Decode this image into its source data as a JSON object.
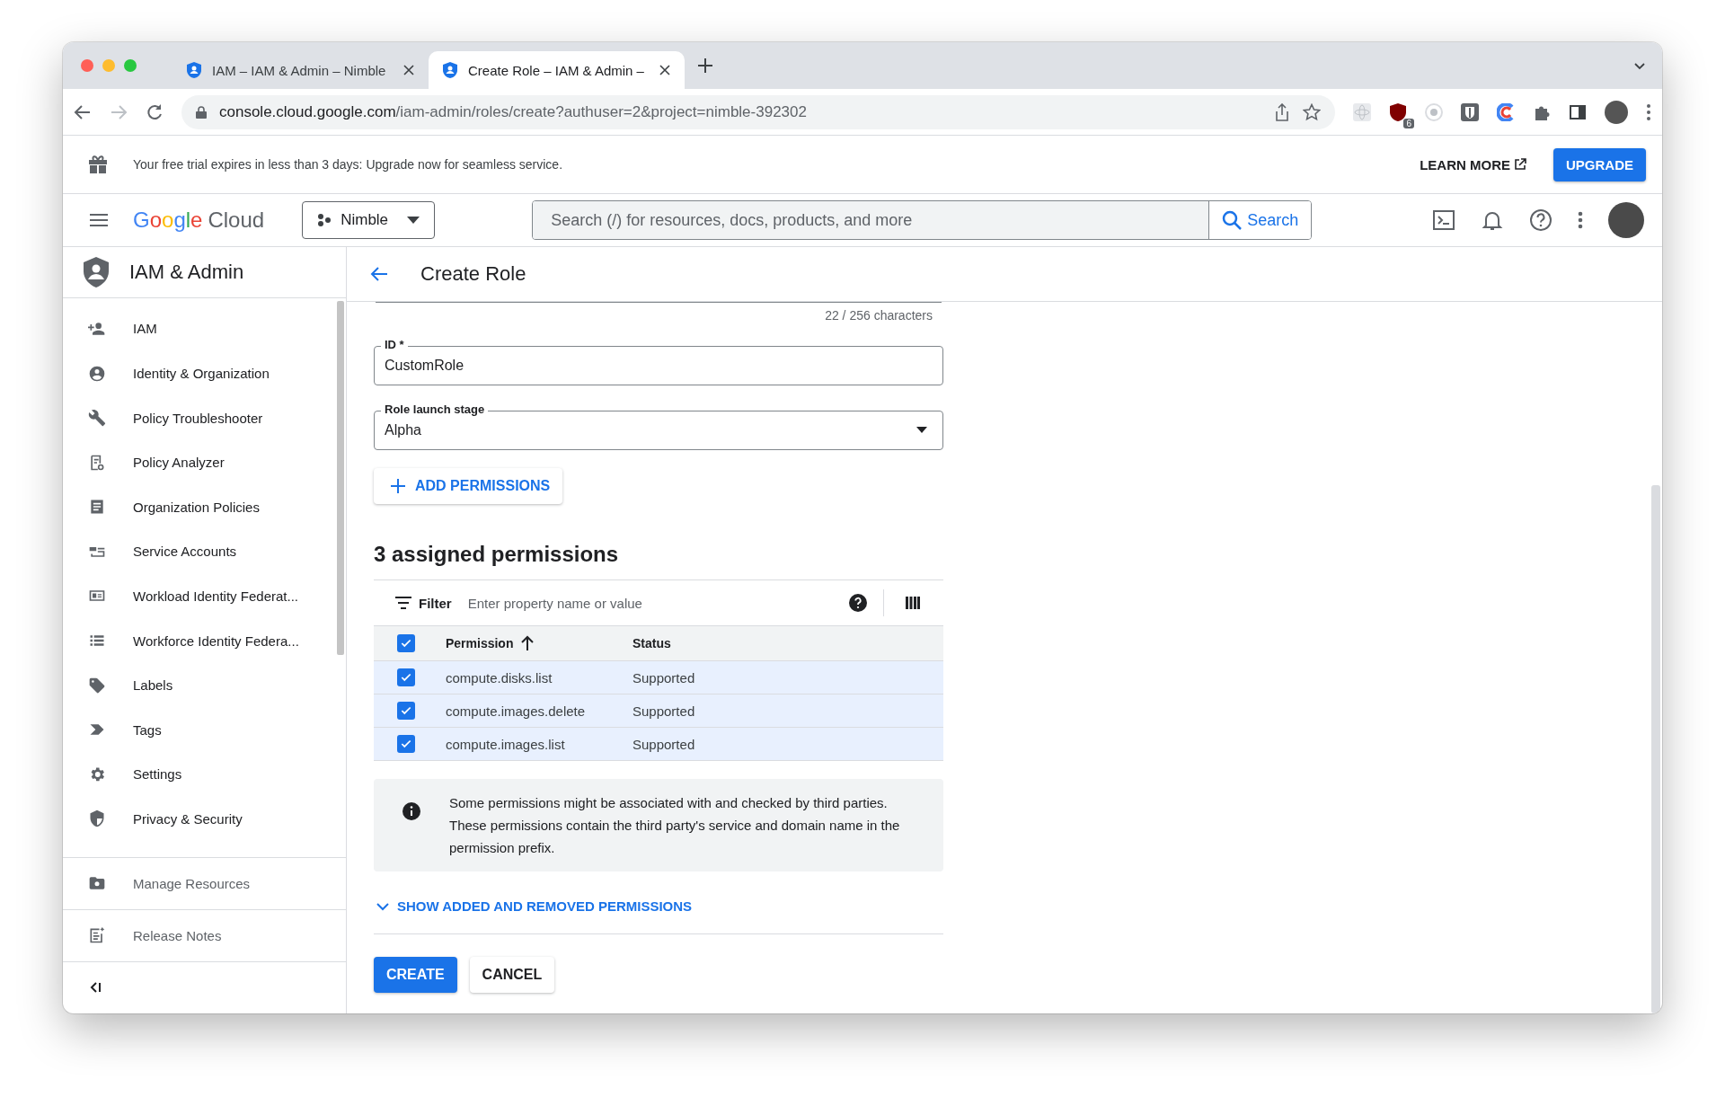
{
  "browser": {
    "tabs": [
      {
        "title": "IAM – IAM & Admin – Nimble",
        "selected": false
      },
      {
        "title": "Create Role – IAM & Admin –",
        "selected": true
      }
    ],
    "url_host": "console.cloud.google.com",
    "url_path": "/iam-admin/roles/create?authuser=2&project=nimble-392302",
    "extension_badge": "6"
  },
  "banner": {
    "text": "Your free trial expires in less than 3 days: Upgrade now for seamless service.",
    "learn_more": "LEARN MORE",
    "upgrade": "UPGRADE"
  },
  "header": {
    "logo_google": "Google",
    "logo_cloud": "Cloud",
    "project": "Nimble",
    "search_placeholder": "Search (/) for resources, docs, products, and more",
    "search_button": "Search"
  },
  "sidebar": {
    "title": "IAM & Admin",
    "items": [
      {
        "label": "IAM"
      },
      {
        "label": "Identity & Organization"
      },
      {
        "label": "Policy Troubleshooter"
      },
      {
        "label": "Policy Analyzer"
      },
      {
        "label": "Organization Policies"
      },
      {
        "label": "Service Accounts"
      },
      {
        "label": "Workload Identity Federat..."
      },
      {
        "label": "Workforce Identity Federa..."
      },
      {
        "label": "Labels"
      },
      {
        "label": "Tags"
      },
      {
        "label": "Settings"
      },
      {
        "label": "Privacy & Security"
      }
    ],
    "footer_items": [
      {
        "label": "Manage Resources"
      },
      {
        "label": "Release Notes"
      }
    ]
  },
  "main": {
    "title": "Create Role",
    "char_count": "22 / 256 characters",
    "fields": [
      {
        "kind": "text",
        "label": "ID *",
        "value": "CustomRole"
      },
      {
        "kind": "select",
        "label": "Role launch stage",
        "value": "Alpha"
      }
    ],
    "add_button": "ADD PERMISSIONS",
    "section_title": "3 assigned permissions",
    "filter": {
      "label": "Filter",
      "placeholder": "Enter property name or value"
    },
    "table": {
      "all_checked": true,
      "columns": [
        {
          "label": "Permission",
          "sorted": true
        },
        {
          "label": "Status",
          "sorted": false
        }
      ],
      "rows": [
        {
          "checked": true,
          "permission": "compute.disks.list",
          "status": "Supported"
        },
        {
          "checked": true,
          "permission": "compute.images.delete",
          "status": "Supported"
        },
        {
          "checked": true,
          "permission": "compute.images.list",
          "status": "Supported"
        }
      ]
    },
    "info": "Some permissions might be associated with and checked by third parties. These permissions contain the third party's service and domain name in the permission prefix.",
    "toggle": "SHOW ADDED AND REMOVED PERMISSIONS",
    "buttons": [
      {
        "kind": "primary",
        "label": "CREATE"
      },
      {
        "kind": "secondary",
        "label": "CANCEL"
      }
    ]
  }
}
